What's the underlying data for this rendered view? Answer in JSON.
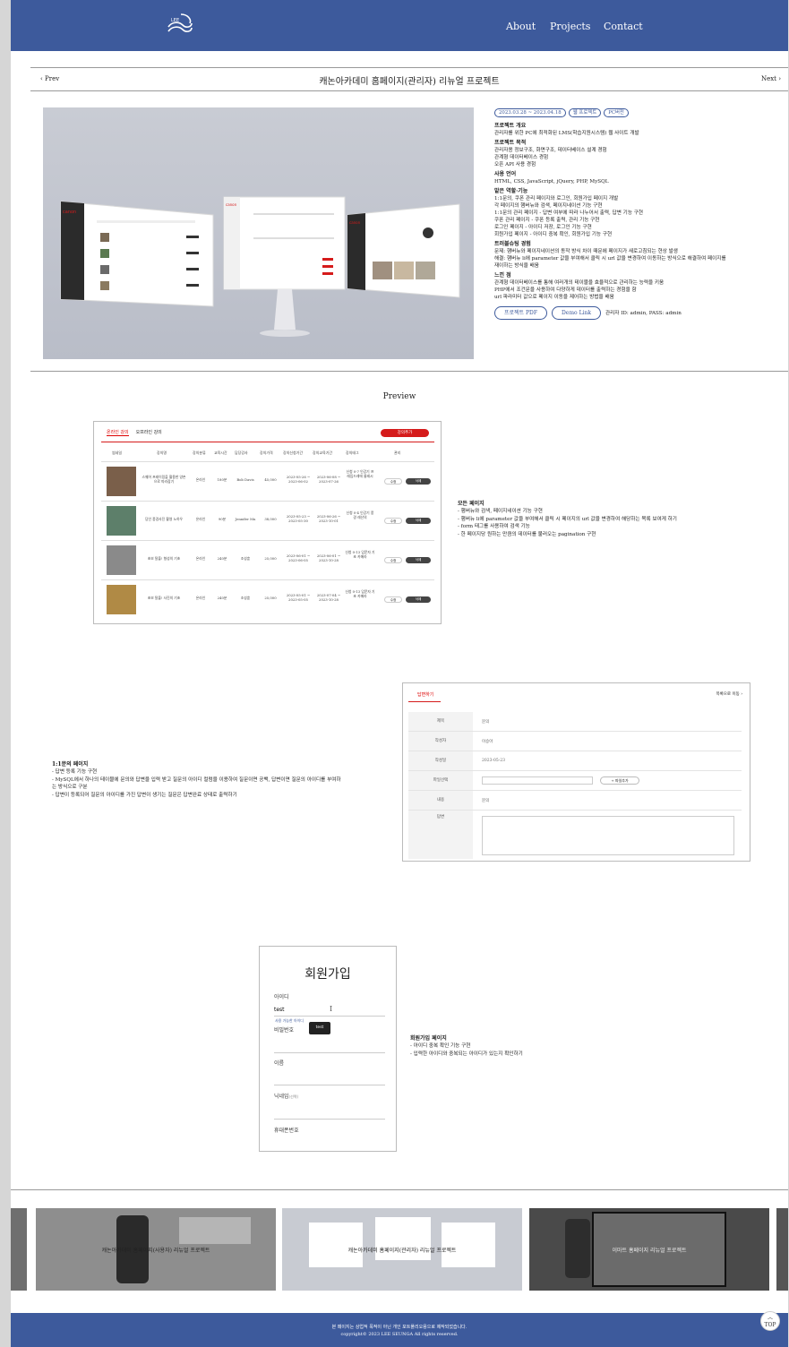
{
  "nav": {
    "about": "About",
    "projects": "Projects",
    "contact": "Contact",
    "logo_text": "LEE"
  },
  "pager": {
    "prev": "‹ Prev",
    "title": "캐논아카데미 홈페이지(관리자) 리뉴얼 프로젝트",
    "next": "Next ›"
  },
  "tags": [
    "2023.03.28 ~ 2023.04.18",
    "웹 프로젝트",
    "PC버전"
  ],
  "sections": [
    {
      "h": "프로젝트 개요",
      "lines": [
        "관리자를 위한 PC에 최적화된 LMS(학습지원시스템) 웹 사이트 개발"
      ]
    },
    {
      "h": "프로젝트 목적",
      "lines": [
        "관리자용 정보구조, 화면구조, 데이터베이스 설계 경험",
        "관계형 데이터베이스 경험",
        "오픈 API 사용 경험"
      ]
    },
    {
      "h": "사용 언어",
      "lines": [
        "HTML, CSS, JavaScript, jQuery, PHP, MySQL"
      ]
    },
    {
      "h": "맡은 역할·기능",
      "lines": [
        "1:1문의, 쿠폰 관리 페이지와 로그인, 회원가입 페이지 개발",
        "각 페이지의 햄버뉴와 검색, 페이지네이션 기능 구현",
        "1:1문의 관리 페이지 - 답변 여부에 따라 나누어서 출력, 답변 기능 구현",
        "쿠폰 관리 페이지 - 쿠폰 등록 출력, 관리 기능 구현",
        "로그인 페이지 - 아이디 저장, 로그인 기능 구현",
        "회원가입 페이지 - 아이디 중복 확인, 회원가입 기능 구현"
      ]
    },
    {
      "h": "트러블슈팅 경험",
      "lines": [
        "문제: 햄버뉴와 페이지네이션의 동작 방식 차이 때문에 페이지가 새로고침되는 현상 발생",
        "해결: 햄버뉴 li에 parameter 값을 부여해서 클릭 시 url 값을 변경하여 이동하는 방식으로 해결하여 페이지를",
        "재이하는 방식을 배움"
      ]
    },
    {
      "h": "느낀 점",
      "lines": [
        "관계형 데이터베이스를 통해 여러개의 테이블을 효율적으로 관리하는 능력을 키움",
        "PHP에서 조건문을 사용하여 다양하게 데이터를 출력하는 경험을 함",
        "url 파라미터 값으로 페이지 이동을 제어하는 방법을 배움"
      ]
    }
  ],
  "buttons": {
    "pdf": "프로젝트 PDF",
    "demo": "Demo Link",
    "account": "관리자 ID: admin, PASS: admin"
  },
  "preview_title": "Preview",
  "lecture_table": {
    "tabs": [
      "온라인 강의",
      "오프라인 강의"
    ],
    "add_button": "강의추가",
    "headers": [
      "썸네일",
      "강의명",
      "강의분류",
      "교육시간",
      "담당강사",
      "강의가격",
      "강의신청기간",
      "강의교육기간",
      "강의태그",
      "관리"
    ],
    "rows": [
      {
        "name": "스퀘어 프레이밍을 활용한 양손으로 따라잡기",
        "cat": "온라인",
        "time": "180분",
        "teacher": "Bob Davis",
        "price": "45,000",
        "apply": "2023-05-26 ~ 2023-06-02",
        "edu": "2023-06-08 ~ 2023-07-26",
        "tag": "신청 0-7 인강기 프레임드레에 룸레시",
        "edit": "수정",
        "del": "삭제"
      },
      {
        "name": "당인 풍경사진 촬영 노하우",
        "cat": "온라인",
        "time": "90분",
        "teacher": "Jennifer Mu",
        "price": "38,000",
        "apply": "2023-05-23 ~ 2023-05-30",
        "edu": "2023-06-26 ~ 2023-10-01",
        "tag": "신청 0-4 인강기 풍경 레산의",
        "edit": "수정",
        "del": "삭제"
      },
      {
        "name": "초보 탈출! 형성의 기초",
        "cat": "온라인",
        "time": "240분",
        "teacher": "조성훈",
        "price": "25,000",
        "apply": "2023-06-01 ~ 2023-06-05",
        "edu": "2023-06-01 ~ 2023-10-28",
        "tag": "신청 0-13 입문자 기초 카메라",
        "edit": "수정",
        "del": "삭제"
      },
      {
        "name": "초보 탈출! 사진의 기초",
        "cat": "온라인",
        "time": "240분",
        "teacher": "조성훈",
        "price": "25,000",
        "apply": "2023-05-01 ~ 2023-05-05",
        "edu": "2023-07-04 ~ 2023-10-28",
        "tag": "신청 0-13 입문자 기초 카메라",
        "edit": "수정",
        "del": "삭제"
      }
    ]
  },
  "desc_all": {
    "title": "모든 페이지",
    "lines": [
      "- 햄버뉴와 검색, 페이지네이션 기능 구현",
      "- 햄버뉴 li에 parameter 값을 부여해서 클릭 시 페이지의 url 값을 변경하여 해당하는 목록 보여게 하기",
      "- form 태그를 사용하여 검색 기능",
      "- 한 페이지당 원하는 만큼의 데이터를 불러오는 pagination 구현"
    ]
  },
  "answer_form": {
    "tab": "답변하기",
    "back": "목록으로 이동 ›",
    "rows": [
      {
        "label": "제목",
        "value": "문의"
      },
      {
        "label": "작성자",
        "value": "이승아"
      },
      {
        "label": "작성일",
        "value": "2023-05-23"
      },
      {
        "label": "파일선택",
        "value": ""
      },
      {
        "label": "내용",
        "value": "문의"
      },
      {
        "label": "답변",
        "value": ""
      }
    ],
    "add_file": "+ 파일추가"
  },
  "desc_qna": {
    "title": "1:1문의 페이지",
    "lines": [
      "- 답변 등록 기능 구현",
      "- MySQL에서 하나의 테이블에 문의와 답변을 입력 받고 질문의 아이디 컬럼을 이용하여 질문이면 공백, 답변이면 질문의 아이디를 부여하",
      "는 방식으로 구분",
      "- 답변이 등록되어 질문의 아이디를 가진 답변이 생기는 질문은 답변완료 상태로 출력하기"
    ]
  },
  "signup": {
    "title": "회원가입",
    "id_label": "아이디",
    "id_value": "test",
    "hint": "사용 가능한 아이디",
    "tooltip": "test",
    "pw_label": "비밀번호",
    "name_label": "이름",
    "nick_label": "닉네임",
    "nick_opt": "(선택)",
    "phone_label": "휴대폰번호"
  },
  "desc_signup": {
    "title": "회원가입 페이지",
    "lines": [
      "- 아이디 중복 확인 기능 구현",
      "- 입력한 아이디와 중복되는 아이디가 있는지 확인하기"
    ]
  },
  "carousel": [
    "캐논아카데미 홈페이지(사용자) 리뉴얼 프로젝트",
    "캐논아카데미 홈페이지(관리자) 리뉴얼 프로젝트",
    "이마트 홈페이지 리뉴얼 프로젝트"
  ],
  "footer": {
    "line1": "본 페이지는 상업적 목적이 아닌 개인 포트폴리오용으로 제작되었습니다.",
    "line2": "copyright© 2023 LEE SEUNGA All rights reserved."
  },
  "top": "TOP"
}
